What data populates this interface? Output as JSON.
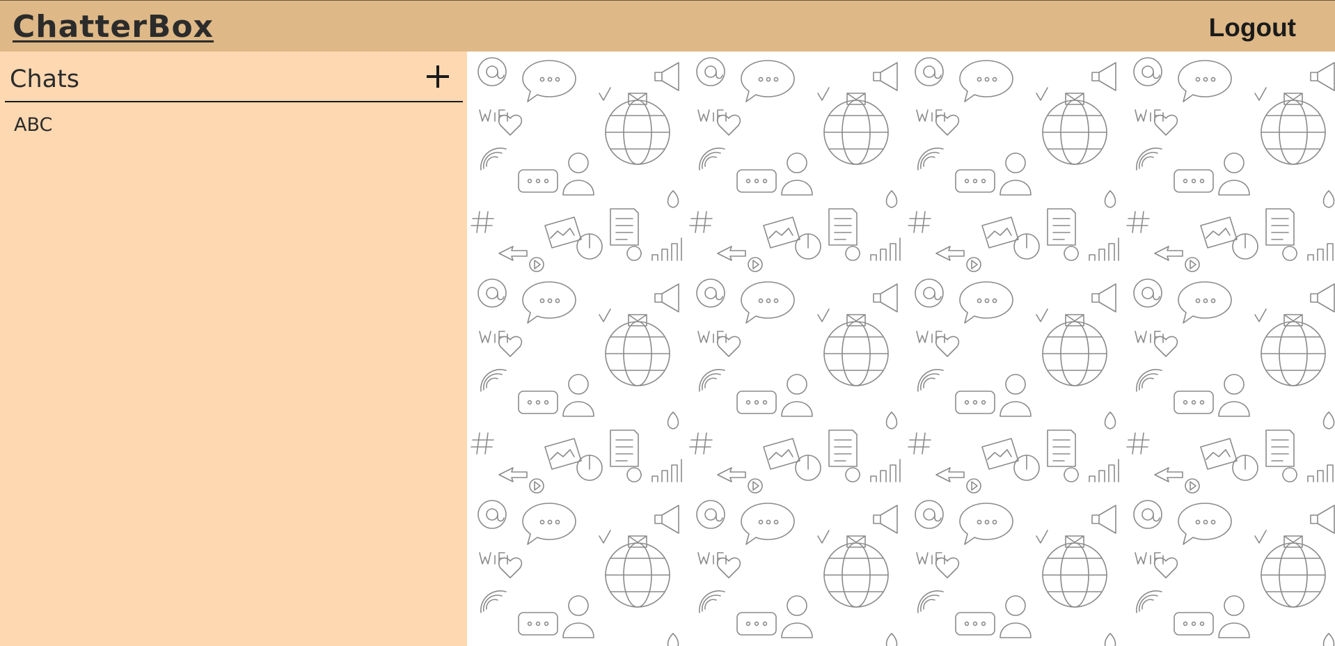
{
  "header": {
    "brand": "ChatterBox",
    "logout_label": "Logout",
    "background_color": "#deb887"
  },
  "sidebar": {
    "title": "Chats",
    "add_icon": "plus-icon",
    "background_color": "#fed8b1",
    "chats": [
      {
        "name": "ABC"
      }
    ]
  },
  "chat_area": {
    "background": "doodle-pattern",
    "pattern_icons": [
      "wifi-icon",
      "globe-icon",
      "speech-bubble-icon",
      "at-sign-icon",
      "hashtag-icon",
      "heart-icon",
      "person-icon",
      "document-icon",
      "image-icon",
      "arrow-icon",
      "signal-bars-icon",
      "play-icon",
      "power-icon",
      "megaphone-icon",
      "envelope-icon",
      "checkmark-icon"
    ]
  }
}
